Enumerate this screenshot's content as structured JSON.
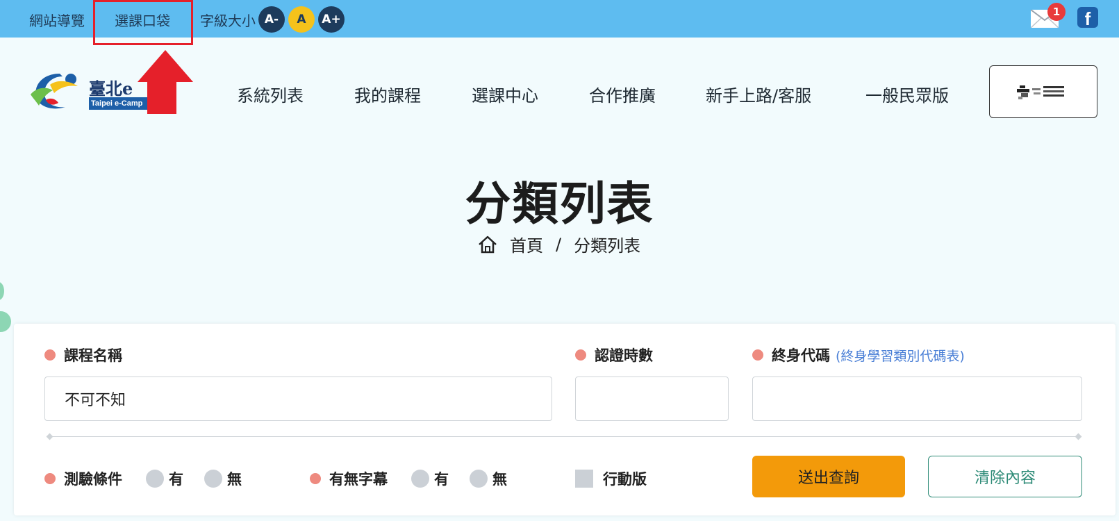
{
  "topbar": {
    "sitemap": "網站導覽",
    "course_bag": "選課口袋",
    "font_size_label": "字級大小",
    "font_smaller": "A-",
    "font_normal": "A",
    "font_larger": "A+",
    "mail_count": "1",
    "facebook_glyph": "f"
  },
  "header": {
    "logo_text": "臺北e",
    "logo_tag": "Taipei e-Camp",
    "nav": [
      "系統列表",
      "我的課程",
      "選課中心",
      "合作推廣",
      "新手上路/客服",
      "一般民眾版"
    ]
  },
  "page": {
    "title": "分類列表",
    "breadcrumb_home": "首頁",
    "breadcrumb_sep": "/",
    "breadcrumb_current": "分類列表"
  },
  "search": {
    "course_name_label": "課程名稱",
    "course_name_value": "不可不知",
    "hours_label": "認證時數",
    "hours_value": "",
    "code_label": "終身代碼",
    "code_link": "(終身學習類別代碼表)",
    "code_value": "",
    "quiz_label": "測驗條件",
    "subtitle_label": "有無字幕",
    "opt_yes": "有",
    "opt_no": "無",
    "mobile_label": "行動版",
    "submit": "送出查詢",
    "clear": "清除內容"
  },
  "colors": {
    "topbar": "#5ebcf0",
    "highlight": "#e5202a",
    "submit": "#f39a0a",
    "clear_border": "#2e8b77",
    "label_dot": "#ee8a7f"
  }
}
